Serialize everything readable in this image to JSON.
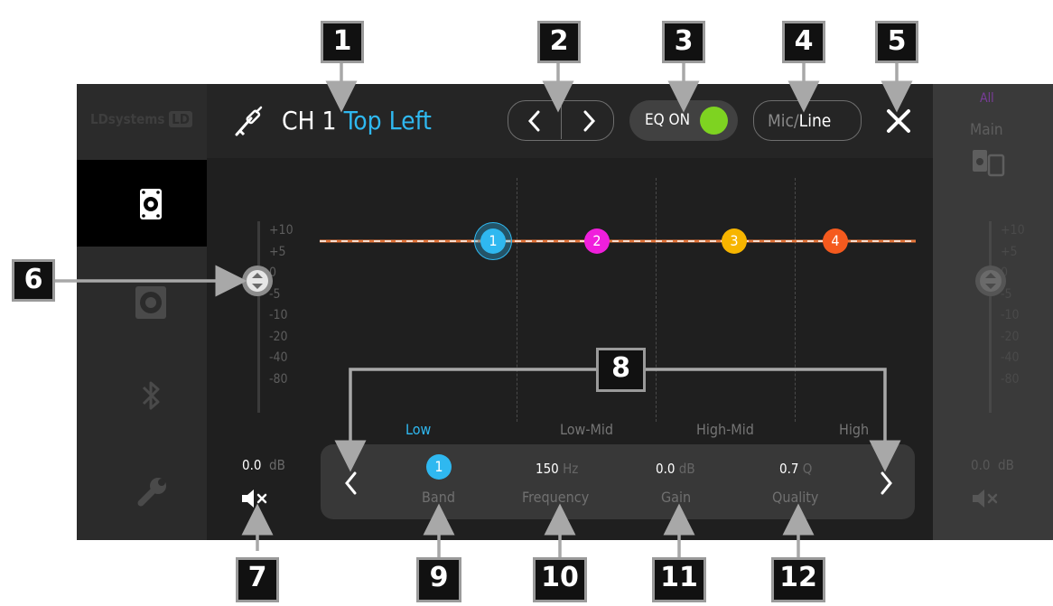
{
  "callouts": [
    "1",
    "2",
    "3",
    "4",
    "5",
    "6",
    "7",
    "8",
    "9",
    "10",
    "11",
    "12"
  ],
  "logo": {
    "text": "LDsystems",
    "badge": "LD"
  },
  "header": {
    "channel_prefix": "CH 1",
    "channel_name": "Top Left",
    "eq_label": "EQ ON",
    "eq_on": true,
    "input_mic": "Mic/",
    "input_line": "Line",
    "close": "✕"
  },
  "left_fader": {
    "scale": [
      "+10",
      "+5",
      "0",
      "-5",
      "-10",
      "-20",
      "-40",
      "-80"
    ],
    "value": "0.0",
    "unit": "dB"
  },
  "right_panel": {
    "all": "All",
    "main": "Main",
    "scale": [
      "+10",
      "+5",
      "0",
      "-5",
      "-10",
      "-20",
      "-40",
      "-80"
    ],
    "value": "0.0",
    "unit": "dB"
  },
  "eq": {
    "bands": [
      {
        "num": "1",
        "color": "#2fb8f0",
        "name": "Low",
        "active": true
      },
      {
        "num": "2",
        "color": "#f01fdc",
        "name": "Low-Mid",
        "active": false
      },
      {
        "num": "3",
        "color": "#f7b500",
        "name": "High-Mid",
        "active": false
      },
      {
        "num": "4",
        "color": "#f55a1e",
        "name": "High",
        "active": false
      }
    ]
  },
  "params": {
    "band_value": "1",
    "band_label": "Band",
    "frequency_value": "150",
    "frequency_unit": "Hz",
    "frequency_label": "Frequency",
    "gain_value": "0.0",
    "gain_unit": "dB",
    "gain_label": "Gain",
    "quality_value": "0.7",
    "quality_unit": "Q",
    "quality_label": "Quality"
  },
  "colors": {
    "accent": "#2fb8f0",
    "eq_on_led": "#7ed321",
    "line_orange": "#e8783c"
  }
}
